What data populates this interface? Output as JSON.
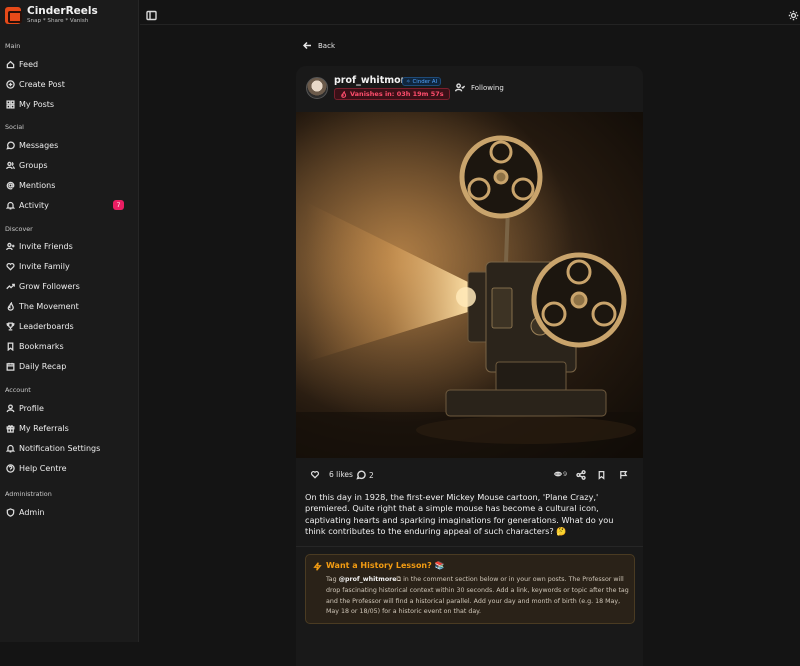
{
  "app": {
    "name": "CinderReels",
    "tagline": "Snap * Share * Vanish"
  },
  "sidebar": {
    "sections": [
      {
        "label": "Main",
        "items": [
          {
            "label": "Feed",
            "icon": "home-icon"
          },
          {
            "label": "Create Post",
            "icon": "plus-circle-icon"
          },
          {
            "label": "My Posts",
            "icon": "grid-icon"
          }
        ]
      },
      {
        "label": "Social",
        "items": [
          {
            "label": "Messages",
            "icon": "chat-icon"
          },
          {
            "label": "Groups",
            "icon": "users-icon"
          },
          {
            "label": "Mentions",
            "icon": "at-icon"
          },
          {
            "label": "Activity",
            "icon": "bell-icon",
            "badge": "7"
          }
        ]
      },
      {
        "label": "Discover",
        "items": [
          {
            "label": "Invite Friends",
            "icon": "user-plus-icon"
          },
          {
            "label": "Invite Family",
            "icon": "heart-icon"
          },
          {
            "label": "Grow Followers",
            "icon": "trending-up-icon"
          },
          {
            "label": "The Movement",
            "icon": "flame-icon"
          },
          {
            "label": "Leaderboards",
            "icon": "trophy-icon"
          },
          {
            "label": "Bookmarks",
            "icon": "bookmark-icon"
          },
          {
            "label": "Daily Recap",
            "icon": "calendar-icon"
          }
        ]
      },
      {
        "label": "Account",
        "items": [
          {
            "label": "Profile",
            "icon": "user-icon"
          },
          {
            "label": "My Referrals",
            "icon": "gift-icon"
          },
          {
            "label": "Notification Settings",
            "icon": "bell-icon"
          },
          {
            "label": "Help Centre",
            "icon": "help-circle-icon"
          }
        ]
      },
      {
        "label": "Administration",
        "items": [
          {
            "label": "Admin",
            "icon": "shield-icon"
          }
        ]
      }
    ]
  },
  "topbar": {
    "left_icon": "sidebar-toggle-icon",
    "right_icon": "sun-icon"
  },
  "post": {
    "back_label": "Back",
    "username": "prof_whitmore",
    "ai_badge": "Cinder AI",
    "vanish_label": "Vanishes in:",
    "vanish_time": "03h 19m 57s",
    "follow_label": "Following",
    "likes": "6 likes",
    "comments": "2",
    "views": "9",
    "caption": "On this day in 1928, the first-ever Mickey Mouse cartoon, 'Plane Crazy,' premiered. Quite right that a simple mouse has become a cultural icon, captivating hearts and sparking imaginations for generations. What do you think contributes to the enduring appeal of such characters? 🤔",
    "history": {
      "title": "Want a History Lesson? 📚",
      "text_pre": "Tag",
      "tag": "@prof_whitmore",
      "text_post": "in the comment section below or in your own posts. The Professor will drop fascinating historical context within 30 seconds. Add a link, keywords or topic after the tag and the Professor will find a historical parallel. Add your day and month of birth (e.g. 18 May, May 18 or 18/05) for a historic event on that day."
    }
  },
  "colors": {
    "accent_orange": "#f39c12",
    "badge_pink": "#e91e63",
    "vanish_red": "#ff4d6d",
    "ai_blue": "#4fa3ff"
  }
}
